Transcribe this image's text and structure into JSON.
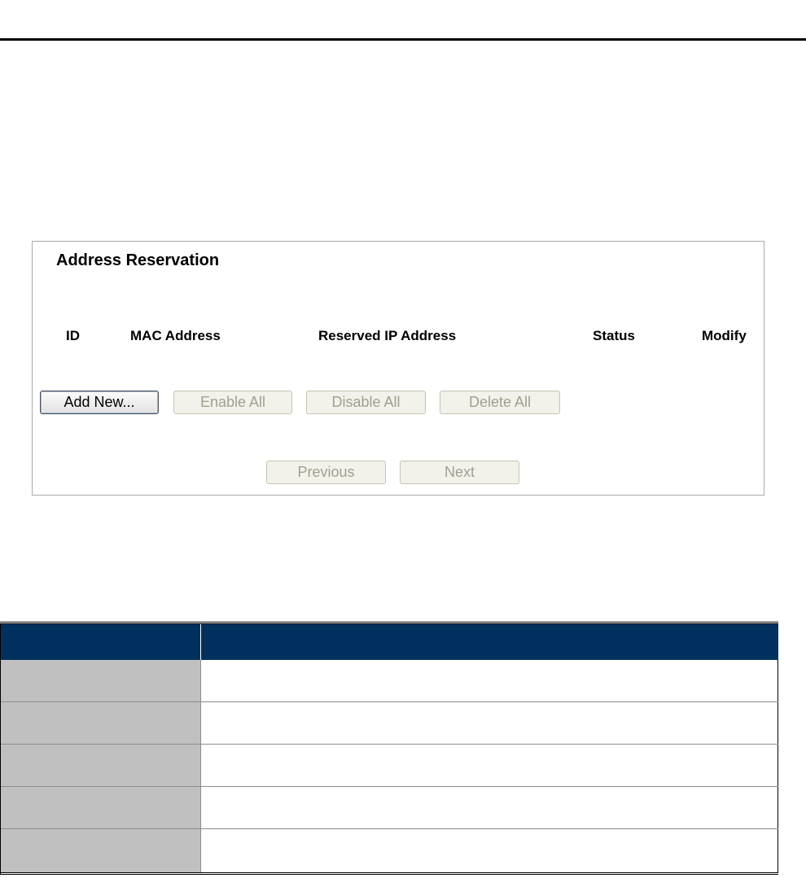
{
  "panel": {
    "title": "Address Reservation",
    "columns": [
      "ID",
      "MAC Address",
      "Reserved IP Address",
      "Status",
      "Modify"
    ]
  },
  "buttons": {
    "add_new": "Add New...",
    "enable_all": "Enable All",
    "disable_all": "Disable All",
    "delete_all": "Delete All",
    "previous": "Previous",
    "next": "Next"
  },
  "colors": {
    "table_header": "#00315e",
    "row_label_bg": "#c0c0c0"
  }
}
